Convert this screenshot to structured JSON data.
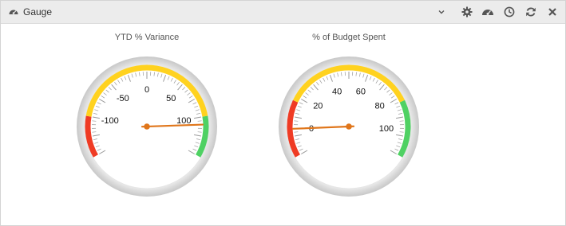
{
  "header": {
    "title": "Gauge",
    "title_icon": "gauge-icon",
    "buttons": [
      "chevron-down-icon",
      "gear-icon",
      "gauge-icon",
      "clock-icon",
      "refresh-icon",
      "close-icon"
    ]
  },
  "colors": {
    "red": "#ef3b24",
    "yellow": "#ffd21f",
    "green": "#4fd163",
    "needle": "#e0761b"
  },
  "chart_data": [
    {
      "type": "gauge",
      "title": "YTD % Variance",
      "min": -150,
      "max": 150,
      "tick_labels": [
        "-100",
        "-50",
        "0",
        "50",
        "100"
      ],
      "bands": [
        {
          "from": -150,
          "to": -100,
          "color": "red"
        },
        {
          "from": -100,
          "to": 100,
          "color": "yellow"
        },
        {
          "from": 100,
          "to": 150,
          "color": "green"
        }
      ],
      "value": 110
    },
    {
      "type": "gauge",
      "title": "% of Budget Spent",
      "min": -15,
      "max": 115,
      "tick_labels": [
        "0",
        "20",
        "40",
        "60",
        "80",
        "100"
      ],
      "bands": [
        {
          "from": -15,
          "to": 15,
          "color": "red"
        },
        {
          "from": 15,
          "to": 85,
          "color": "yellow"
        },
        {
          "from": 85,
          "to": 115,
          "color": "green"
        }
      ],
      "value": 0
    }
  ]
}
